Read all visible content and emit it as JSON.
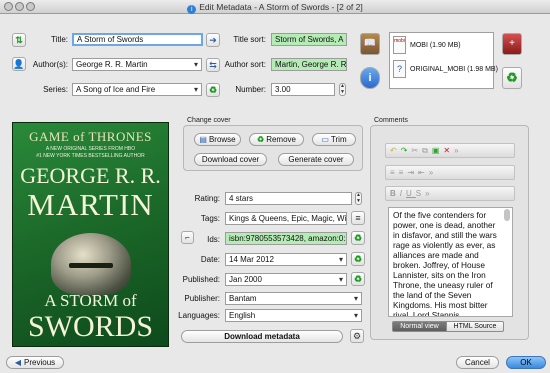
{
  "window": {
    "title": "Edit Metadata - A Storm of Swords  -  [2 of 2]"
  },
  "fields": {
    "title_label": "Title:",
    "title_value": "A Storm of Swords",
    "title_sort_label": "Title sort:",
    "title_sort_value": "Storm of Swords, A",
    "authors_label": "Author(s):",
    "authors_value": "George R. R. Martin",
    "author_sort_label": "Author sort:",
    "author_sort_value": "Martin, George R. R.",
    "series_label": "Series:",
    "series_value": "A Song of Ice and Fire",
    "number_label": "Number:",
    "number_value": "3.00"
  },
  "formats": [
    {
      "icon_text": "mobi",
      "label": "MOBI (1.90 MB)"
    },
    {
      "icon_text": "?",
      "label": "ORIGINAL_MOBI (1.98 MB)"
    }
  ],
  "cover_art": {
    "series_name": "GAME of THRONES",
    "tagline1": "A NEW ORIGINAL SERIES FROM HBO",
    "tagline2": "#1 NEW YORK TIMES BESTSELLING AUTHOR",
    "author_first": "GEORGE R. R.",
    "author_last": "MARTIN",
    "title_top": "A STORM of",
    "title_bottom": "SWORDS"
  },
  "change_cover": {
    "group_label": "Change cover",
    "browse": "Browse",
    "remove": "Remove",
    "trim": "Trim",
    "download_cover": "Download cover",
    "generate_cover": "Generate cover"
  },
  "meta": {
    "rating_label": "Rating:",
    "rating_value": "4 stars",
    "tags_label": "Tags:",
    "tags_value": "Kings & Queens, Epic, Magic, Wir",
    "ids_label": "Ids:",
    "ids_value": "isbn:9780553573428, amazon:0:",
    "date_label": "Date:",
    "date_value": "14 Mar 2012",
    "published_label": "Published:",
    "published_value": "Jan 2000",
    "publisher_label": "Publisher:",
    "publisher_value": "Bantam",
    "languages_label": "Languages:",
    "languages_value": "English",
    "download_metadata": "Download metadata"
  },
  "comments": {
    "group_label": "Comments",
    "text": "Of the five contenders for power, one is dead, another in disfavor, and still the wars rage as violently as ever, as alliances are made and broken. Joffrey, of House Lannister, sits on the Iron Throne, the uneasy ruler of the land of the Seven Kingdoms. His most bitter rival, Lord Stannis,",
    "tab_normal": "Normal view",
    "tab_html": "HTML Source"
  },
  "bottom": {
    "previous": "Previous",
    "cancel": "Cancel",
    "ok": "OK"
  }
}
